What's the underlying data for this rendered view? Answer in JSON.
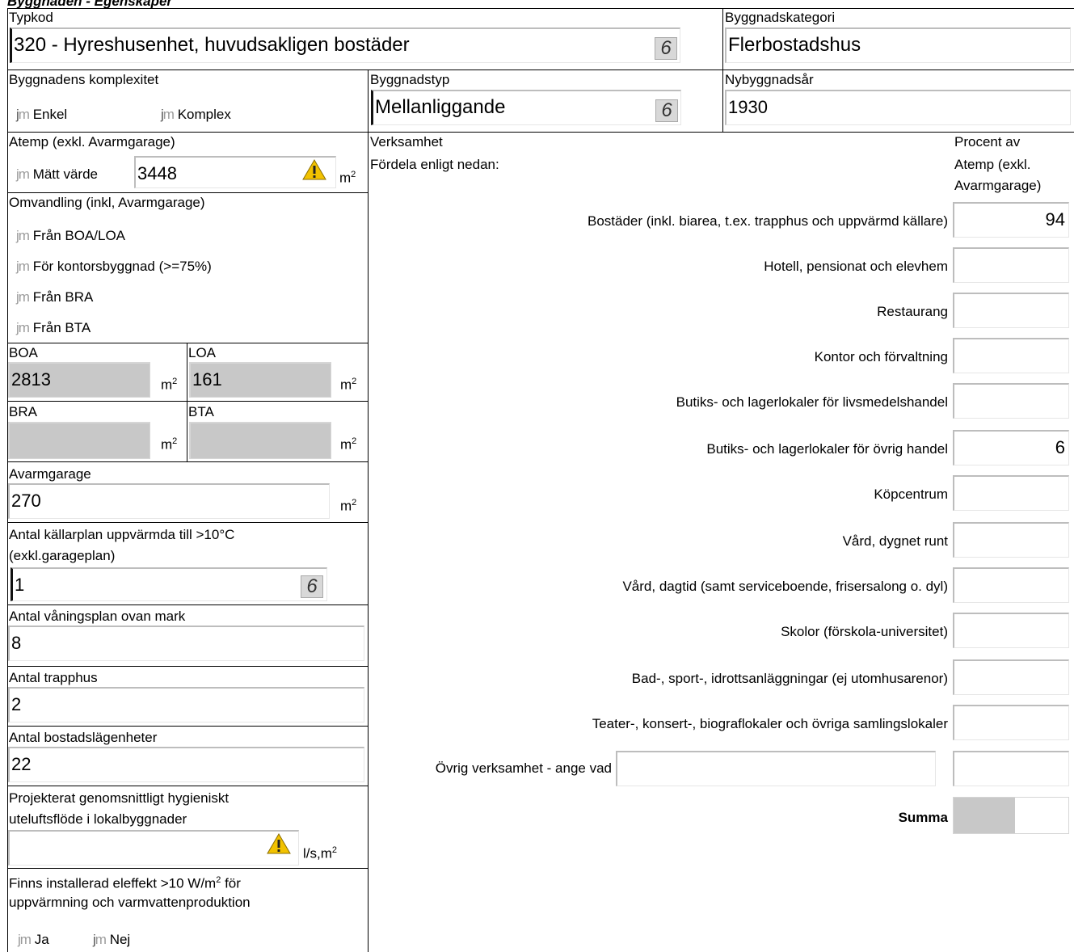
{
  "page_title": "Byggnaden - Egenskaper",
  "typkod": {
    "label": "Typkod",
    "value": "320 - Hyreshusenhet, huvudsakligen bostäder"
  },
  "byggnadskategori": {
    "label": "Byggnadskategori",
    "value": "Flerbostadshus"
  },
  "komplexitet": {
    "label": "Byggnadens komplexitet",
    "options": [
      "Enkel",
      "Komplex"
    ]
  },
  "byggnadstyp": {
    "label": "Byggnadstyp",
    "value": "Mellanliggande"
  },
  "nybyggnadsar": {
    "label": "Nybyggnadsår",
    "value": "1930"
  },
  "atemp": {
    "label": "Atemp (exkl. Avarmgarage)",
    "option": "Mätt värde",
    "value": "3448",
    "unit": "m",
    "unit_sup": "2"
  },
  "omvandling": {
    "label": "Omvandling (inkl, Avarmgarage)",
    "options": [
      "Från BOA/LOA",
      "För kontorsbyggnad (>=75%)",
      "Från BRA",
      "Från BTA"
    ]
  },
  "boa": {
    "label": "BOA",
    "value": "2813",
    "unit": "m",
    "unit_sup": "2"
  },
  "loa": {
    "label": "LOA",
    "value": "161",
    "unit": "m",
    "unit_sup": "2"
  },
  "bra": {
    "label": "BRA",
    "value": "",
    "unit": "m",
    "unit_sup": "2"
  },
  "bta": {
    "label": "BTA",
    "value": "",
    "unit": "m",
    "unit_sup": "2"
  },
  "avarmgarage": {
    "label": "Avarmgarage",
    "value": "270",
    "unit": "m",
    "unit_sup": "2"
  },
  "kallarplan": {
    "label_line1": "Antal källarplan uppvärmda till >10°C",
    "label_line2": "(exkl.garageplan)",
    "value": "1"
  },
  "vaningsplan": {
    "label": "Antal våningsplan ovan mark",
    "value": "8"
  },
  "trapphus": {
    "label": "Antal trapphus",
    "value": "2"
  },
  "lagenheter": {
    "label": "Antal bostadslägenheter",
    "value": "22"
  },
  "uteluft": {
    "label_line1": "Projekterat genomsnittligt hygieniskt",
    "label_line2": "uteluftsflöde i lokalbyggnader",
    "value": "",
    "unit": "l/s,m",
    "unit_sup": "2"
  },
  "eleffekt": {
    "label_line1_pre": "Finns installerad eleffekt >10 W/m",
    "label_line1_sup": "2",
    "label_line1_post": " för",
    "label_line2": "uppvärmning och varmvattenproduktion",
    "options": [
      "Ja",
      "Nej"
    ]
  },
  "verksamhet": {
    "label": "Verksamhet",
    "sublabel": "Fördela enligt nedan:",
    "pct_header": [
      "Procent av",
      "Atemp (exkl.",
      "Avarmgarage)"
    ],
    "rows": [
      {
        "label": "Bostäder (inkl. biarea, t.ex. trapphus och uppvärmd källare)",
        "value": "94"
      },
      {
        "label": "Hotell, pensionat och elevhem",
        "value": ""
      },
      {
        "label": "Restaurang",
        "value": ""
      },
      {
        "label": "Kontor och förvaltning",
        "value": ""
      },
      {
        "label": "Butiks- och lagerlokaler för livsmedelshandel",
        "value": ""
      },
      {
        "label": "Butiks- och lagerlokaler för övrig handel",
        "value": "6"
      },
      {
        "label": "Köpcentrum",
        "value": ""
      },
      {
        "label": "Vård, dygnet runt",
        "value": ""
      },
      {
        "label": "Vård, dagtid (samt serviceboende, frisersalong o. dyl)",
        "value": ""
      },
      {
        "label": "Skolor (förskola-universitet)",
        "value": ""
      },
      {
        "label": "Bad-, sport-, idrottsanläggningar (ej utomhusarenor)",
        "value": ""
      },
      {
        "label": "Teater-, konsert-, biograflokaler och övriga samlingslokaler",
        "value": ""
      }
    ],
    "ovrig": {
      "label": "Övrig verksamhet - ange vad",
      "text": "",
      "value": ""
    },
    "summa": {
      "label": "Summa",
      "value": ""
    }
  }
}
